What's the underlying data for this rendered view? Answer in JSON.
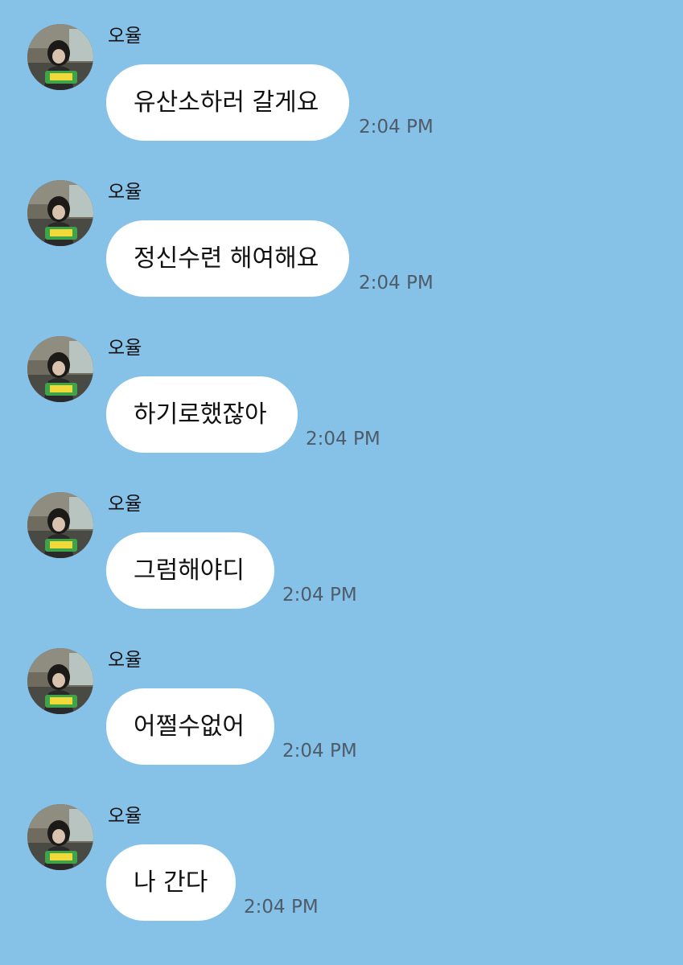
{
  "theme": {
    "background": "#86C1E8",
    "bubble_color": "#FFFFFF",
    "text_color": "#111111",
    "time_color": "#4E5C69"
  },
  "messages": [
    {
      "sender": "오율",
      "text": "유산소하러 갈게요",
      "time": "2:04 PM",
      "avatar": "profile-photo"
    },
    {
      "sender": "오율",
      "text": "정신수련 해여해요",
      "time": "2:04 PM",
      "avatar": "profile-photo"
    },
    {
      "sender": "오율",
      "text": "하기로했잖아",
      "time": "2:04 PM",
      "avatar": "profile-photo"
    },
    {
      "sender": "오율",
      "text": "그럼해야디",
      "time": "2:04 PM",
      "avatar": "profile-photo"
    },
    {
      "sender": "오율",
      "text": "어쩔수없어",
      "time": "2:04 PM",
      "avatar": "profile-photo"
    },
    {
      "sender": "오율",
      "text": "나 간다",
      "time": "2:04 PM",
      "avatar": "profile-photo"
    }
  ]
}
